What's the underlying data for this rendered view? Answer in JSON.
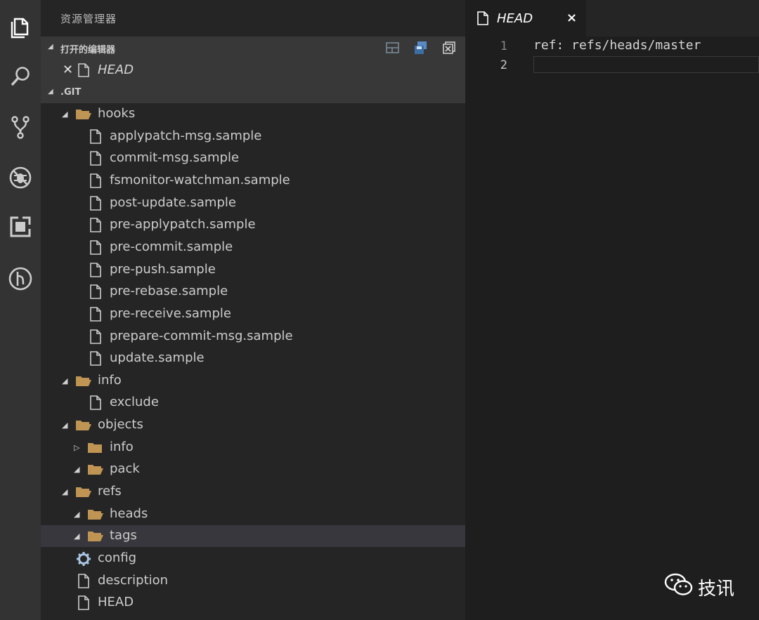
{
  "activity_bar": {
    "icons": [
      "files-icon",
      "search-icon",
      "source-control-icon",
      "debug-icon",
      "extensions-icon",
      "git-graph-icon"
    ]
  },
  "sidebar": {
    "title": "资源管理器",
    "open_editors": {
      "label": "打开的编辑器",
      "items": [
        {
          "name": "HEAD"
        }
      ]
    },
    "folder": {
      "label": ".GIT"
    },
    "tree": [
      {
        "name": "hooks",
        "type": "folder",
        "depth": 1,
        "expanded": true
      },
      {
        "name": "applypatch-msg.sample",
        "type": "file",
        "depth": 2
      },
      {
        "name": "commit-msg.sample",
        "type": "file",
        "depth": 2
      },
      {
        "name": "fsmonitor-watchman.sample",
        "type": "file",
        "depth": 2
      },
      {
        "name": "post-update.sample",
        "type": "file",
        "depth": 2
      },
      {
        "name": "pre-applypatch.sample",
        "type": "file",
        "depth": 2
      },
      {
        "name": "pre-commit.sample",
        "type": "file",
        "depth": 2
      },
      {
        "name": "pre-push.sample",
        "type": "file",
        "depth": 2
      },
      {
        "name": "pre-rebase.sample",
        "type": "file",
        "depth": 2
      },
      {
        "name": "pre-receive.sample",
        "type": "file",
        "depth": 2
      },
      {
        "name": "prepare-commit-msg.sample",
        "type": "file",
        "depth": 2
      },
      {
        "name": "update.sample",
        "type": "file",
        "depth": 2
      },
      {
        "name": "info",
        "type": "folder",
        "depth": 1,
        "expanded": true
      },
      {
        "name": "exclude",
        "type": "file",
        "depth": 2
      },
      {
        "name": "objects",
        "type": "folder",
        "depth": 1,
        "expanded": true
      },
      {
        "name": "info",
        "type": "folder",
        "depth": 2,
        "expanded": false
      },
      {
        "name": "pack",
        "type": "folder",
        "depth": 2,
        "expanded": true
      },
      {
        "name": "refs",
        "type": "folder",
        "depth": 1,
        "expanded": true
      },
      {
        "name": "heads",
        "type": "folder",
        "depth": 2,
        "expanded": true
      },
      {
        "name": "tags",
        "type": "folder",
        "depth": 2,
        "expanded": true,
        "selected": true
      },
      {
        "name": "config",
        "type": "config",
        "depth": 1
      },
      {
        "name": "description",
        "type": "file",
        "depth": 1
      },
      {
        "name": "HEAD",
        "type": "file",
        "depth": 1
      }
    ]
  },
  "editor": {
    "tab": {
      "label": "HEAD",
      "close": "×"
    },
    "lines": [
      {
        "num": "1",
        "text": "ref: refs/heads/master"
      },
      {
        "num": "2",
        "text": ""
      }
    ]
  },
  "watermark": {
    "text": "技讯"
  },
  "colors": {
    "folder": "#c09553",
    "activity_bg": "#333333",
    "sidebar_bg": "#252526",
    "editor_bg": "#1e1e1e"
  }
}
